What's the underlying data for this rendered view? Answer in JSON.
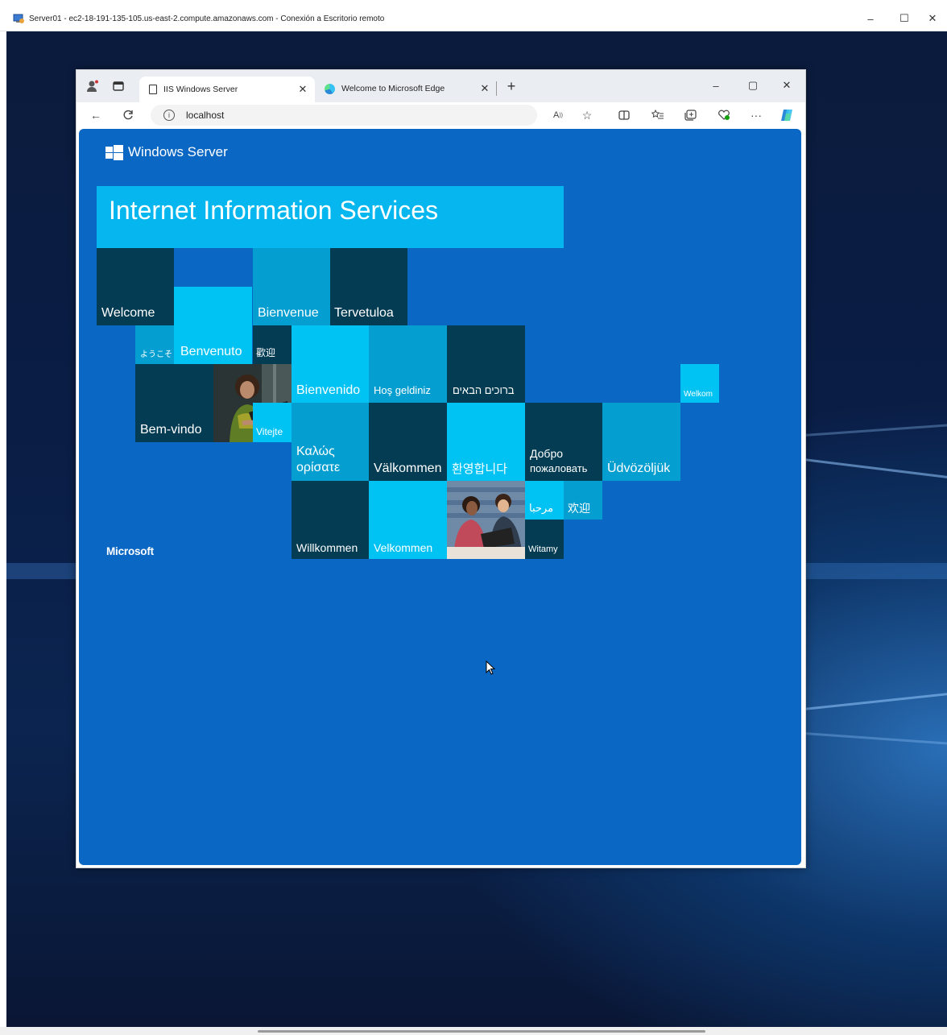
{
  "rdp": {
    "title": "Server01 - ec2-18-191-135-105.us-east-2.compute.amazonaws.com - Conexión a Escritorio remoto",
    "minimize": "–",
    "maximize": "☐",
    "close": "✕"
  },
  "browser": {
    "tabs": [
      {
        "title": "IIS Windows Server",
        "active": true
      },
      {
        "title": "Welcome to Microsoft Edge",
        "active": false
      }
    ],
    "new_tab": "+",
    "url": "localhost",
    "window_controls": {
      "minimize": "–",
      "maximize": "▢",
      "close": "✕"
    }
  },
  "page": {
    "brand": "Windows Server",
    "title": "Internet Information Services",
    "footer": "Microsoft",
    "tiles": [
      {
        "id": "welcome",
        "text": "Welcome"
      },
      {
        "id": "bienvenue",
        "text": "Bienvenue"
      },
      {
        "id": "tervetuloa",
        "text": "Tervetuloa"
      },
      {
        "id": "youkoso",
        "text": "ようこそ"
      },
      {
        "id": "benvenuto",
        "text": "Benvenuto"
      },
      {
        "id": "huanying-trad",
        "text": "歡迎"
      },
      {
        "id": "bienvenido",
        "text": "Bienvenido"
      },
      {
        "id": "hos-geldiniz",
        "text": "Hoş geldiniz"
      },
      {
        "id": "brukhim",
        "text": "ברוכים הבאים"
      },
      {
        "id": "welkom",
        "text": "Welkom"
      },
      {
        "id": "bem-vindo",
        "text": "Bem-vindo"
      },
      {
        "id": "vitejte",
        "text": "Vitejte"
      },
      {
        "id": "kalos-1",
        "text": "Καλώς"
      },
      {
        "id": "kalos-2",
        "text": "ορίσατε"
      },
      {
        "id": "valkommen",
        "text": "Välkommen"
      },
      {
        "id": "hwanyeong",
        "text": "환영합니다"
      },
      {
        "id": "dobro-1",
        "text": "Добро"
      },
      {
        "id": "dobro-2",
        "text": "пожаловать"
      },
      {
        "id": "udvozoljuk",
        "text": "Üdvözöljük"
      },
      {
        "id": "marhaba",
        "text": "مرحبا"
      },
      {
        "id": "huanying-simp",
        "text": "欢迎"
      },
      {
        "id": "willkommen",
        "text": "Willkommen"
      },
      {
        "id": "velkommen",
        "text": "Velkommen"
      },
      {
        "id": "witamy",
        "text": "Witamy"
      }
    ]
  },
  "colors": {
    "page_bg": "#0a67c4",
    "tile_dark": "#043c53",
    "tile_cyan": "#05b7ee",
    "tile_teal": "#059ed0",
    "tile_light": "#00c2f3"
  }
}
